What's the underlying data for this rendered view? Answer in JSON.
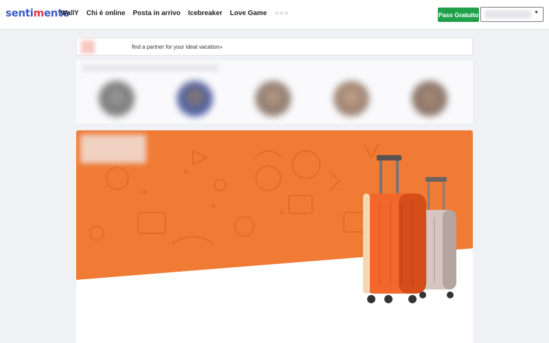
{
  "logo": {
    "prefix": "senti",
    "heart": "m",
    "suffix": "ente"
  },
  "nav": [
    {
      "label": "WallY"
    },
    {
      "label": "Chi è online"
    },
    {
      "label": "Posta in arrivo"
    },
    {
      "label": "Icebreaker"
    },
    {
      "label": "Love Game"
    },
    {
      "label": "○○○"
    }
  ],
  "actions": {
    "pass_button": "Pass Gratuito",
    "dropdown_value": ""
  },
  "promo_card": {
    "text": "find a partner for your ideal vacation»"
  },
  "colors": {
    "brand_blue": "#3b5cc4",
    "heart_red": "#e8334a",
    "pass_green": "#1fa049",
    "banner_orange": "#ef7b35"
  }
}
